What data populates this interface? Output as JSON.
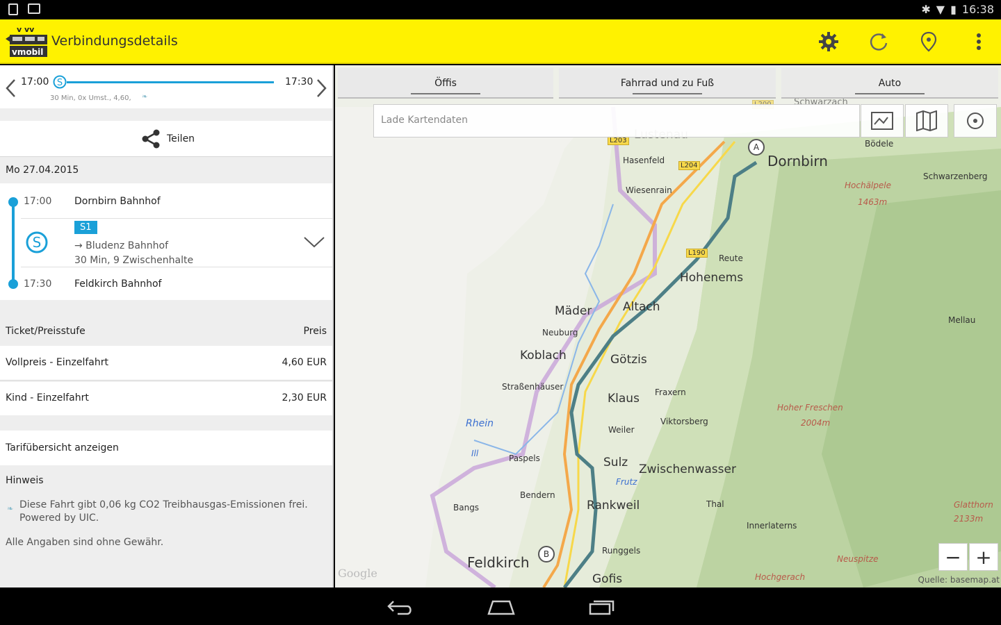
{
  "status_bar": {
    "time": "16:38"
  },
  "app_bar": {
    "title": "Verbindungsdetails",
    "logo_text": "vmobil"
  },
  "connection": {
    "depart_time": "17:00",
    "arrive_time": "17:30",
    "summary": "30 Min, 0x Umst., 4,60,",
    "progress": 1.0
  },
  "share_label": "Teilen",
  "date": "Mo 27.04.2015",
  "journey": {
    "start_time": "17:00",
    "start_stop": "Dornbirn Bahnhof",
    "line": "S1",
    "direction": "→ Bludenz Bahnhof",
    "duration": "30 Min, 9 Zwischenhalte",
    "end_time": "17:30",
    "end_stop": "Feldkirch Bahnhof"
  },
  "tickets": {
    "header_left": "Ticket/Preisstufe",
    "header_right": "Preis",
    "rows": [
      {
        "name": "Vollpreis - Einzelfahrt",
        "price": "4,60 EUR"
      },
      {
        "name": "Kind - Einzelfahrt",
        "price": "2,30 EUR"
      }
    ]
  },
  "tariff_link": "Tarifübersicht anzeigen",
  "notes": {
    "title": "Hinweis",
    "co2": "Diese Fahrt gibt 0,06 kg CO2 Treibhausgas-Emissionen frei.",
    "powered": "Powered by UIC.",
    "disclaimer": "Alle Angaben sind ohne Gewähr."
  },
  "map": {
    "tabs": [
      "Öffis",
      "Fahrrad und zu Fuß",
      "Auto"
    ],
    "search_placeholder": "Lade Kartendaten",
    "attribution_left": "Google",
    "attribution_right": "Quelle: basemap.at",
    "places": {
      "dornbirn": "Dornbirn",
      "hohenems": "Hohenems",
      "altach": "Altach",
      "mader": "Mäder",
      "koblach": "Koblach",
      "gotzis": "Götzis",
      "klaus": "Klaus",
      "sulz": "Sulz",
      "zwischenwasser": "Zwischenwasser",
      "rankweil": "Rankweil",
      "feldkirch": "Feldkirch",
      "gofis": "Gofis",
      "lustenau": "Lustenau",
      "hasenfeld": "Hasenfeld",
      "wiesenrain": "Wiesenrain",
      "neuburg": "Neuburg",
      "strassenhauser": "Straßenhäuser",
      "weiler": "Weiler",
      "viktorsberg": "Viktorsberg",
      "fraxern": "Fraxern",
      "reute": "Reute",
      "bodele": "Bödele",
      "schwarzenberg": "Schwarzenberg",
      "schwarzach": "Schwarzach",
      "mellau": "Mellau",
      "paspels": "Paspels",
      "bendern": "Bendern",
      "bangs": "Bangs",
      "thal": "Thal",
      "innerlaterns": "Innerlaterns",
      "runggels": "Runggels",
      "rhein": "Rhein",
      "frutz": "Frutz",
      "ill": "Ill",
      "hochalpele": "Hochälpele",
      "hochalpele_h": "1463m",
      "hoher_freschen": "Hoher Freschen",
      "hoher_freschen_h": "2004m",
      "glatthorn": "Glatthorn",
      "glatthorn_h": "2133m",
      "hochgerach": "Hochgerach",
      "neuspitze": "Neuspitze"
    },
    "roads": [
      "L203",
      "L204",
      "L190",
      "L200"
    ],
    "markers": [
      "A",
      "B"
    ]
  }
}
